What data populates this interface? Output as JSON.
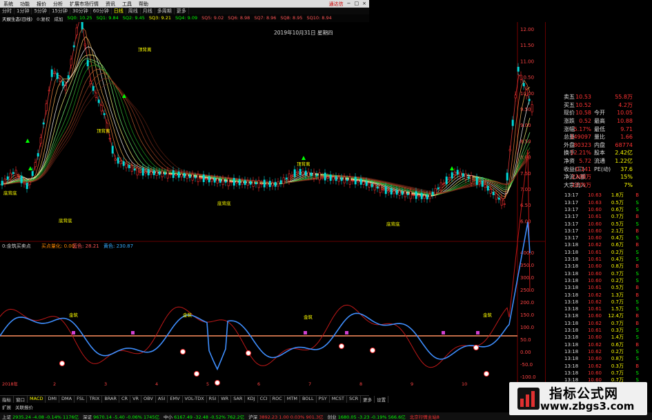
{
  "menu": {
    "items": [
      "系统",
      "功能",
      "报价",
      "分析",
      "扩展市场行情",
      "资讯",
      "工具",
      "帮助"
    ],
    "right": [
      "通达信"
    ]
  },
  "toolbar": {
    "periods": [
      "分时",
      "1分钟",
      "5分钟",
      "15分钟",
      "30分钟",
      "60分钟",
      "日线",
      "周线",
      "月线",
      "多周期",
      "更多"
    ]
  },
  "infobar": {
    "stock": "天娱生态(日线)",
    "items": [
      "0:复权",
      "成加",
      "SQ0: 10.25",
      "SQ1: 9.84",
      "SQ2: 9.45",
      "SQ3: 9.21",
      "SQ4: 9.09",
      "SQ5: 9.02",
      "SQ6: 8.98",
      "SQ7: 8.96",
      "SQ8: 8.95",
      "SQ10: 8.94"
    ]
  },
  "date_label": "2019年10月31日 星期四",
  "chart_labels": {
    "high": "12.78",
    "buy_signals": [
      "买",
      "买",
      "买"
    ],
    "sell_signals": [
      "卖",
      "卖"
    ],
    "annot": [
      "底背底",
      "底背底",
      "底背底",
      "底背底",
      "顶背离",
      "顶背离",
      "顶背离"
    ]
  },
  "yaxis_upper": [
    "12.00",
    "11.50",
    "11.00",
    "10.50",
    "10.00",
    "9.50",
    "9.00",
    "8.50",
    "8.00",
    "7.50",
    "7.00",
    "6.50",
    "6.00"
  ],
  "yaxis_lower": [
    "400.0",
    "350.0",
    "300.0",
    "250.0",
    "200.0",
    "150.0",
    "100.0",
    "50.0",
    "0.00",
    "-50.0",
    "-100.0",
    "-150.0"
  ],
  "indicator_bar": {
    "name": "0:金筑买卖点",
    "items": [
      "买点量化: 0.00",
      "蓝色: 28.21",
      "黄色: 230.87"
    ]
  },
  "xaxis": [
    "2018年",
    "2",
    "3",
    "4",
    "5",
    "6",
    "7",
    "8",
    "9",
    "10",
    "11"
  ],
  "tabs": [
    "指标",
    "窗口",
    "MACD",
    "DMI",
    "DMA",
    "FSL",
    "TRIX",
    "BRAR",
    "CR",
    "VR",
    "OBV",
    "ASI",
    "EMV",
    "VOL-TDX",
    "RSI",
    "WR",
    "SAR",
    "KDJ",
    "CCI",
    "ROC",
    "MTM",
    "BOLL",
    "PSY",
    "MCST",
    "SCR",
    "更多",
    "设置"
  ],
  "subtabs": [
    "扩展",
    "关联报价"
  ],
  "quote": [
    {
      "k": "卖五",
      "v": "10.53",
      "k2": "",
      "v2": "55.8万"
    },
    {
      "k": "买五",
      "v": "10.52",
      "k2": "",
      "v2": "4.2万"
    },
    {
      "k": "现价",
      "v": "10.58",
      "k2": "今开",
      "v2": "10.05"
    },
    {
      "k": "涨跌",
      "v": "0.52",
      "k2": "最高",
      "v2": "10.88"
    },
    {
      "k": "涨幅",
      "v": "5.17%",
      "k2": "最低",
      "v2": "9.71"
    },
    {
      "k": "总量",
      "v": "149097",
      "k2": "量比",
      "v2": "1.66"
    },
    {
      "k": "外盘",
      "v": "80323",
      "k2": "内盘",
      "v2": "68774"
    },
    {
      "k": "换手",
      "v": "12.21%",
      "k2": "股本",
      "v2": "2.42亿"
    },
    {
      "k": "净资",
      "v": "5.72",
      "k2": "流通",
      "v2": "1.22亿"
    },
    {
      "k": "收益(三)",
      "v": "0.141",
      "k2": "PE(动)",
      "v2": "37.6"
    },
    {
      "k": "净流入额",
      "v": "2309万",
      "k2": "",
      "v2": "15%"
    },
    {
      "k": "大宗流入",
      "v": "1079万",
      "k2": "",
      "v2": "7%"
    }
  ],
  "ticks": [
    {
      "t": "13:17",
      "p": "10.63",
      "q": "1.8万",
      "s": "B"
    },
    {
      "t": "13:17",
      "p": "10.63",
      "q": "0.5万",
      "s": "S"
    },
    {
      "t": "13:17",
      "p": "10.60",
      "q": "0.6万",
      "s": "S"
    },
    {
      "t": "13:17",
      "p": "10.61",
      "q": "0.7万",
      "s": "B"
    },
    {
      "t": "13:17",
      "p": "10.60",
      "q": "0.5万",
      "s": "S"
    },
    {
      "t": "13:17",
      "p": "10.60",
      "q": "2.1万",
      "s": "B"
    },
    {
      "t": "13:17",
      "p": "10.60",
      "q": "0.4万",
      "s": "S"
    },
    {
      "t": "13:18",
      "p": "10.62",
      "q": "0.6万",
      "s": "B"
    },
    {
      "t": "13:18",
      "p": "10.61",
      "q": "0.2万",
      "s": "S"
    },
    {
      "t": "13:18",
      "p": "10.61",
      "q": "0.4万",
      "s": "S"
    },
    {
      "t": "13:18",
      "p": "10.60",
      "q": "0.8万",
      "s": "B"
    },
    {
      "t": "13:18",
      "p": "10.60",
      "q": "0.7万",
      "s": "S"
    },
    {
      "t": "13:18",
      "p": "10.60",
      "q": "0.2万",
      "s": "S"
    },
    {
      "t": "13:18",
      "p": "10.61",
      "q": "0.5万",
      "s": "B"
    },
    {
      "t": "13:18",
      "p": "10.62",
      "q": "1.3万",
      "s": "B"
    },
    {
      "t": "13:18",
      "p": "10.62",
      "q": "0.7万",
      "s": "S"
    },
    {
      "t": "13:18",
      "p": "10.61",
      "q": "1.5万",
      "s": "S"
    },
    {
      "t": "13:18",
      "p": "10.60",
      "q": "12.4万",
      "s": "B"
    },
    {
      "t": "13:18",
      "p": "10.62",
      "q": "0.7万",
      "s": "B"
    },
    {
      "t": "13:18",
      "p": "10.61",
      "q": "0.3万",
      "s": "S"
    },
    {
      "t": "13:18",
      "p": "10.60",
      "q": "1.4万",
      "s": "S"
    },
    {
      "t": "13:18",
      "p": "10.62",
      "q": "0.6万",
      "s": "B"
    },
    {
      "t": "13:18",
      "p": "10.62",
      "q": "0.2万",
      "s": "S"
    },
    {
      "t": "13:18",
      "p": "10.60",
      "q": "0.8万",
      "s": "S"
    },
    {
      "t": "13:18",
      "p": "10.62",
      "q": "0.3万",
      "s": "B"
    },
    {
      "t": "13:18",
      "p": "10.60",
      "q": "0.7万",
      "s": "S"
    },
    {
      "t": "13:18",
      "p": "10.60",
      "q": "0.7万",
      "s": "S"
    }
  ],
  "status": [
    {
      "label": "上证",
      "vals": "2935.24  -4.08  -0.14%  1176亿"
    },
    {
      "label": "深证",
      "vals": "9670.14  -5.40  -0.06%  1745亿"
    },
    {
      "label": "中小",
      "vals": "6167.49  -32.48  -0.52%  762.2亿"
    },
    {
      "label": "沪深",
      "vals": "3892.23  1.00  0.03%  901.3亿"
    },
    {
      "label": "创业",
      "vals": "1680.05  -3.23  -0.19%  566.6亿"
    },
    {
      "label": "",
      "vals": "北京行情主站8"
    }
  ],
  "watermark": {
    "title": "指标公式网",
    "url": "www.zbgs3.com"
  },
  "colors": {
    "up": "#ff3030",
    "down": "#00e0e0",
    "buy": "#ffff00",
    "blue_line": "#3f8fff",
    "red_line": "#e02020"
  }
}
